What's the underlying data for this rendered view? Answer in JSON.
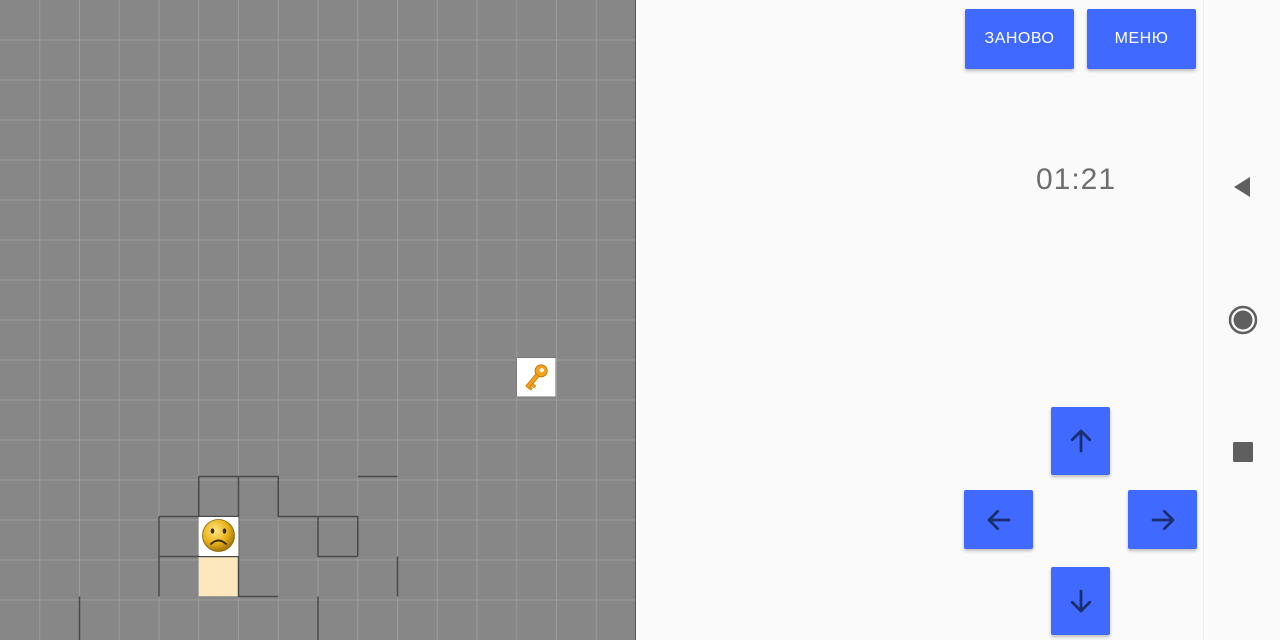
{
  "game": {
    "grid": {
      "cols": 16,
      "rows": 16
    },
    "opened_cells": [
      [
        4,
        13
      ],
      [
        5,
        13
      ],
      [
        5,
        14
      ]
    ],
    "player": {
      "col": 5,
      "row": 13,
      "icon": "sad-face-icon",
      "state": "sad"
    },
    "key": {
      "col": 13,
      "row": 9,
      "icon": "key-icon"
    },
    "colors": {
      "board": "#878787",
      "grid_line": "#9c9c9c",
      "wall_line": "#4a4a4a",
      "opened_cell": "#fde7bd",
      "visible_cell": "#ffffff",
      "accent": "#3f69ff"
    }
  },
  "controls": {
    "restart_label": "ЗАНОВО",
    "menu_label": "МЕНЮ",
    "timer": "01:21",
    "up_icon": "arrow-up-icon",
    "left_icon": "arrow-left-icon",
    "right_icon": "arrow-right-icon",
    "down_icon": "arrow-down-icon"
  },
  "navbar": {
    "back_icon": "back-triangle-icon",
    "home_icon": "home-circle-icon",
    "recents_icon": "recents-square-icon"
  }
}
